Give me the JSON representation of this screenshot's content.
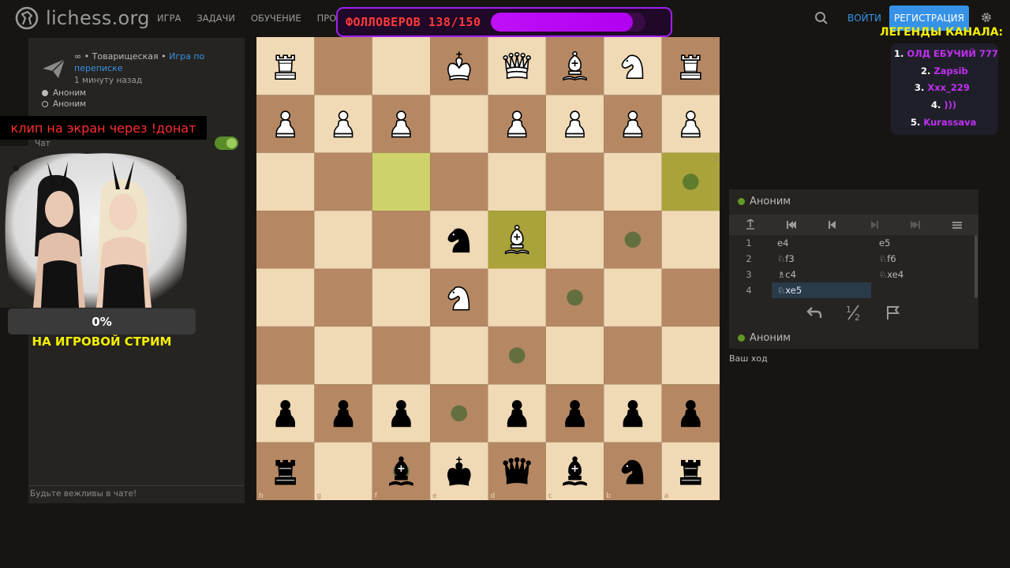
{
  "header": {
    "brand": "lichess.org",
    "nav": [
      "ИГРА",
      "ЗАДАЧИ",
      "ОБУЧЕНИЕ",
      "ПРОСМО"
    ],
    "login": "ВОЙТИ",
    "signup": "РЕГИСТРАЦИЯ"
  },
  "overlay": {
    "followers_text": "ФОЛЛОВЕРОВ 138/150",
    "followers_progress": 0.92,
    "legends_title": "ЛЕГЕНДЫ КАНАЛА:",
    "legends": [
      {
        "num": "1.",
        "name": "ОЛД ЕБУЧИЙ 777"
      },
      {
        "num": "2.",
        "name": "Zapsib"
      },
      {
        "num": "3.",
        "name": "Xxx_229"
      },
      {
        "num": "4.",
        "name": ")))"
      },
      {
        "num": "5.",
        "name": "Kurassava"
      }
    ],
    "clip_banner": "клип на экран через !донат",
    "donation_percent": "0%",
    "donation_caption": "НА ИГРОВОЙ СТРИМ"
  },
  "game": {
    "type_prefix": "∞ • Товарищеская • ",
    "type_link": "Игра по переписке",
    "when": "1 минуту назад",
    "player_white": "Аноним",
    "player_black": "Аноним"
  },
  "chat": {
    "label": "Чат",
    "footer": "Будьте вежливы в чате!"
  },
  "board": {
    "ranks": [
      "1",
      "2",
      "3",
      "4",
      "5",
      "6",
      "7",
      "8"
    ],
    "files": [
      "h",
      "g",
      "f",
      "e",
      "d",
      "c",
      "b",
      "a"
    ],
    "pieces": [
      "R . . K Q B N R",
      "P P P . P P P P",
      ". . . . . . . .",
      ". . . n B . . .",
      ". . . N . . . .",
      ". . . . . . . .",
      "p p p . p p p p",
      "r . b k q b n r"
    ],
    "highlights": [
      [
        0,
        2,
        2
      ],
      [
        0,
        3,
        4
      ],
      [
        0,
        2,
        7
      ]
    ],
    "dests": [
      [
        7,
        2
      ],
      [
        6,
        3
      ],
      [
        5,
        4
      ],
      [
        4,
        5
      ],
      [
        3,
        6
      ],
      [
        2,
        7
      ]
    ]
  },
  "moves_panel": {
    "player_top": "Аноним",
    "player_bottom": "Аноним",
    "moves": [
      {
        "n": "1",
        "w": "e4",
        "b": "e5"
      },
      {
        "n": "2",
        "w": "♘f3",
        "b": "♘f6"
      },
      {
        "n": "3",
        "w": "♗c4",
        "b": "♘xe4"
      },
      {
        "n": "4",
        "w": "♘xe5",
        "b": ""
      }
    ],
    "current_move_index": 3,
    "your_turn": "Ваш ход"
  },
  "colors": {
    "light_square": "#f0d9b5",
    "dark_square": "#b58863",
    "last_move_light": "#cdd26a",
    "last_move_dark": "#aaa23a",
    "accent": "#3692e7",
    "online": "#629924"
  }
}
